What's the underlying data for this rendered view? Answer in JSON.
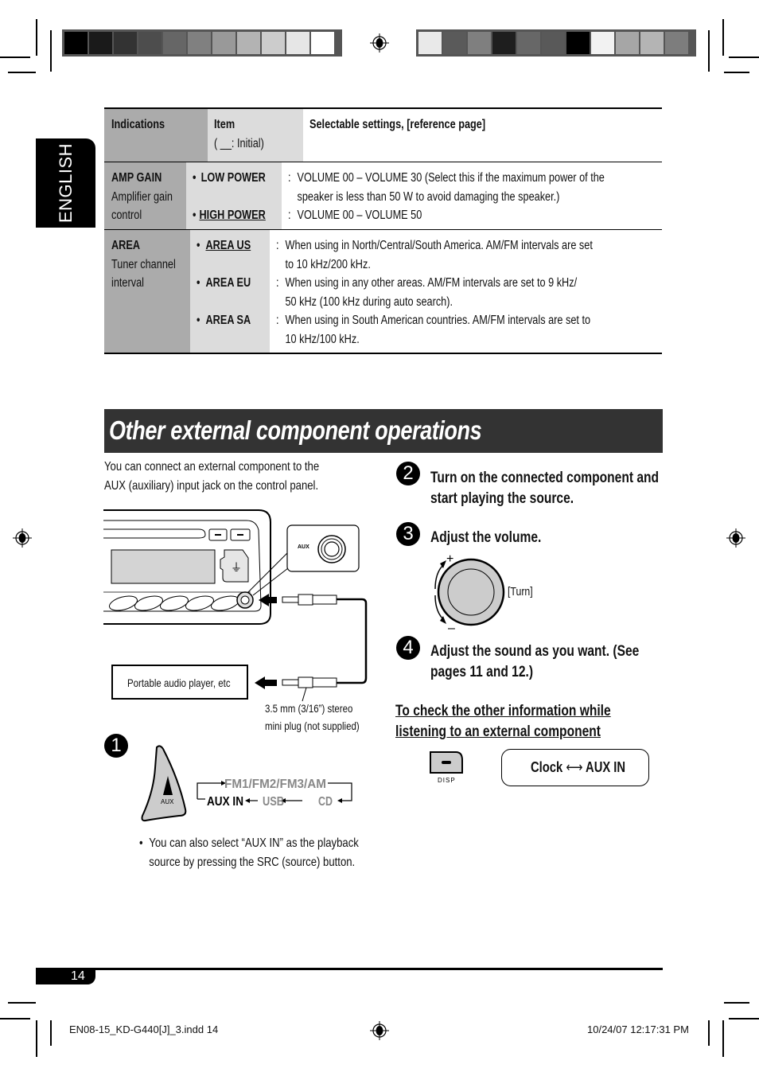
{
  "language_tab": "ENGLISH",
  "color_bar_left": [
    "#000000",
    "#1a1a1a",
    "#333333",
    "#4d4d4d",
    "#666666",
    "#808080",
    "#999999",
    "#b3b3b3",
    "#cccccc",
    "#e6e6e6",
    "#ffffff"
  ],
  "color_bar_right": [
    "#e9e9e9",
    "#5a5a5a",
    "#7f7f7f",
    "#1e1e1e",
    "#676767",
    "#595959",
    "#000000",
    "#f2f2f2",
    "#a6a6a6",
    "#b4b4b4",
    "#7d7d7d"
  ],
  "settings_table": {
    "headers": {
      "indications": "Indications",
      "item": "Item",
      "item_note": "( __: Initial)",
      "settings": "Selectable settings, [reference page]"
    },
    "rows": [
      {
        "indication_title": "AMP GAIN",
        "indication_desc": [
          "Amplifier gain",
          "control"
        ],
        "items": [
          {
            "label": "LOW POWER",
            "initial": false,
            "lines": [
              "VOLUME 00 – VOLUME 30 (Select this if the maximum power of the",
              "speaker is less than 50 W to avoid damaging the speaker.)"
            ]
          },
          {
            "label": "HIGH POWER",
            "initial": true,
            "lines": [
              "VOLUME 00 – VOLUME 50"
            ]
          }
        ]
      },
      {
        "indication_title": "AREA",
        "indication_desc": [
          "Tuner channel",
          "interval"
        ],
        "items": [
          {
            "label": "AREA US",
            "initial": true,
            "lines": [
              "When using in North/Central/South America. AM/FM intervals are set",
              "to 10 kHz/200 kHz."
            ]
          },
          {
            "label": "AREA EU",
            "initial": false,
            "lines": [
              "When using in any other areas. AM/FM intervals are set to 9 kHz/",
              "50 kHz (100 kHz during auto search)."
            ]
          },
          {
            "label": "AREA SA",
            "initial": false,
            "lines": [
              "When using in South American countries. AM/FM intervals are set to",
              "10 kHz/100 kHz."
            ]
          }
        ]
      }
    ]
  },
  "section": {
    "title": "Other external component operations",
    "intro": [
      "You can connect an external component to the",
      "AUX (auxiliary) input jack on the control panel."
    ]
  },
  "diagram": {
    "aux_label": "AUX",
    "player_label": "Portable audio player, etc",
    "plug_caption": [
      "3.5 mm (3/16”) stereo",
      "mini plug (not supplied)"
    ]
  },
  "steps": [
    {
      "num": "1",
      "source_cycle": {
        "top": "FM1/FM2/FM3/AM",
        "aux": "AUX IN",
        "usb": "USB",
        "cd": "CD"
      },
      "button_label": "AUX",
      "note": [
        "You can also select “AUX IN” as the playback",
        "source by pressing the SRC (source) button."
      ]
    },
    {
      "num": "2",
      "title": [
        "Turn on the connected component and",
        "start playing the source."
      ]
    },
    {
      "num": "3",
      "title": [
        "Adjust the volume."
      ],
      "knob_label": "[Turn]",
      "plus": "+",
      "minus": "–"
    },
    {
      "num": "4",
      "title": [
        "Adjust the sound as you want. (See",
        "pages 11 and 12.)"
      ]
    }
  ],
  "info": {
    "heading": [
      "To check the other information while",
      "listening to an external component"
    ],
    "button_label": "DISP",
    "display_left": "Clock",
    "display_right": "AUX IN"
  },
  "page_number": "14",
  "footer": {
    "file": "EN08-15_KD-G440[J]_3.indd   14",
    "timestamp": "10/24/07   12:17:31 PM"
  }
}
